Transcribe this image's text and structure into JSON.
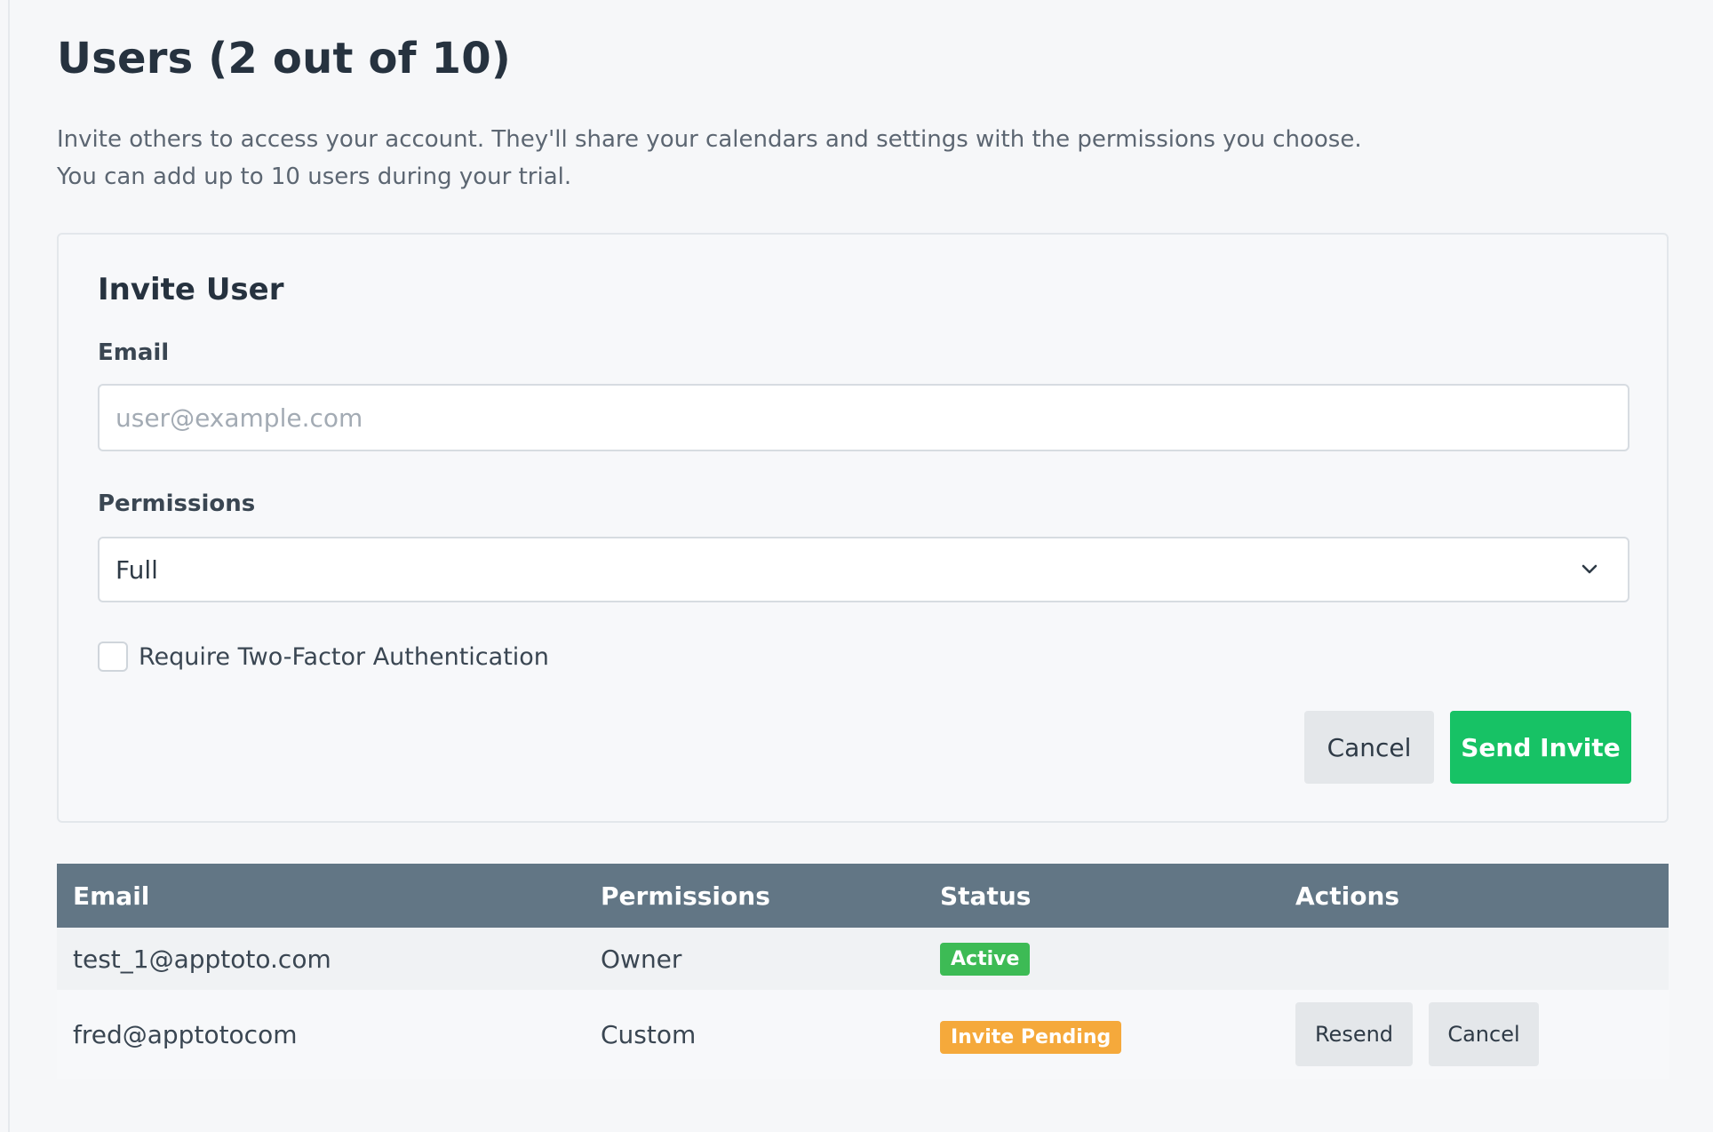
{
  "page": {
    "title": "Users (2 out of 10)",
    "intro_line_1": "Invite others to access your account. They'll share your calendars and settings with the permissions you choose.",
    "intro_line_2": "You can add up to 10 users during your trial."
  },
  "invite_form": {
    "title": "Invite User",
    "email_label": "Email",
    "email_placeholder": "user@example.com",
    "email_value": "",
    "permissions_label": "Permissions",
    "permissions_selected": "Full",
    "two_factor_label": "Require Two-Factor Authentication",
    "two_factor_checked": false,
    "cancel_label": "Cancel",
    "send_label": "Send Invite"
  },
  "table": {
    "headers": [
      "Email",
      "Permissions",
      "Status",
      "Actions"
    ],
    "rows": [
      {
        "email": "test_1@apptoto.com",
        "permissions": "Owner",
        "status": "Active",
        "actions": []
      },
      {
        "email": "fred@apptotocom",
        "permissions": "Custom",
        "status": "Invite Pending",
        "actions": [
          "Resend",
          "Cancel"
        ]
      }
    ]
  },
  "colors": {
    "primary_green": "#17c265",
    "table_header": "#627685",
    "badge_active": "#3dbb55",
    "badge_pending": "#f5a93b"
  }
}
